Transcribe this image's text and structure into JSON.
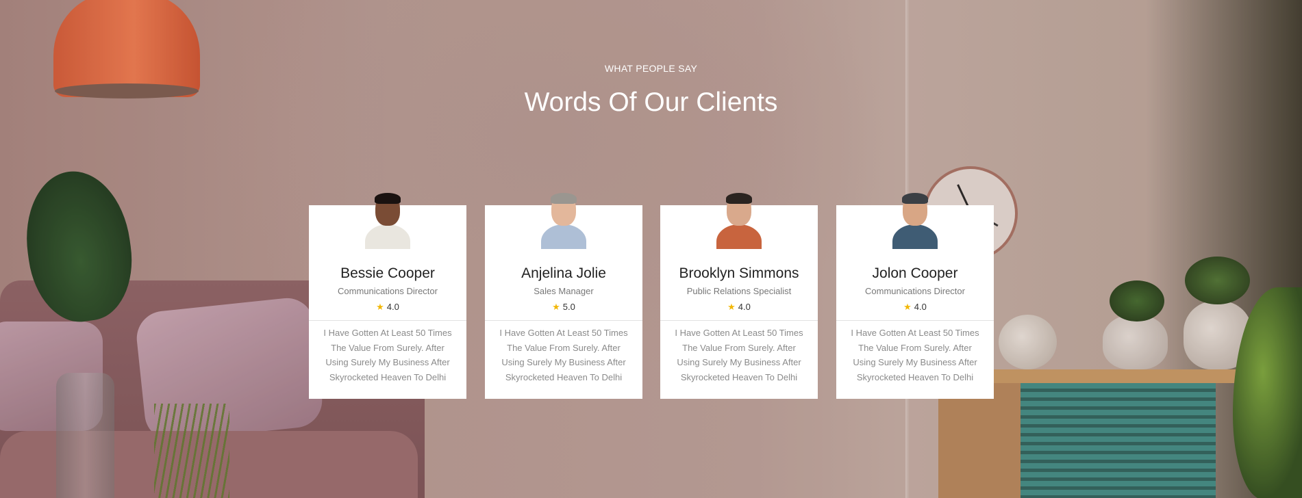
{
  "section": {
    "eyebrow": "WHAT PEOPLE SAY",
    "title": "Words Of Our Clients"
  },
  "colors": {
    "card_bg": "#ffffff",
    "star": "#f2b705",
    "heading_text": "#ffffff",
    "name_text": "#222222",
    "meta_text": "#777777"
  },
  "testimonials": [
    {
      "name": "Bessie Cooper",
      "role": "Communications Director",
      "rating": "4.0",
      "quote": "I Have Gotten At Least 50 Times The Value From Surely. After Using Surely My Business After Skyrocketed Heaven To Delhi",
      "avatar": "avatar-photo"
    },
    {
      "name": "Anjelina Jolie",
      "role": "Sales Manager",
      "rating": "5.0",
      "quote": "I Have Gotten At Least 50 Times The Value From Surely. After Using Surely My Business After Skyrocketed Heaven To Delhi",
      "avatar": "avatar-photo"
    },
    {
      "name": "Brooklyn Simmons",
      "role": "Public Relations Specialist",
      "rating": "4.0",
      "quote": "I Have Gotten At Least 50 Times The Value From Surely. After Using Surely My Business After Skyrocketed Heaven To Delhi",
      "avatar": "avatar-photo"
    },
    {
      "name": "Jolon Cooper",
      "role": "Communications Director",
      "rating": "4.0",
      "quote": "I Have Gotten At Least 50 Times The Value From Surely. After Using Surely My Business After Skyrocketed Heaven To Delhi",
      "avatar": "avatar-photo"
    }
  ],
  "star_icon": "star-icon"
}
